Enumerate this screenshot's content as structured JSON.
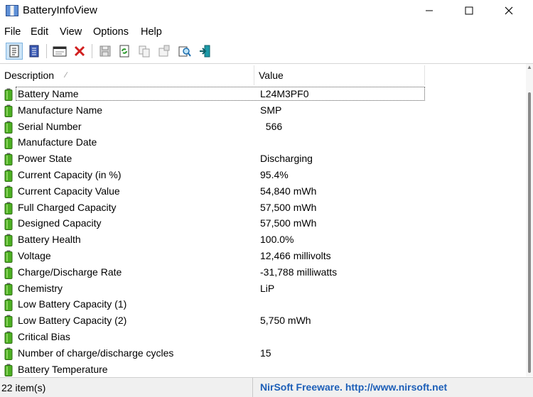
{
  "window": {
    "title": "BatteryInfoView"
  },
  "menu": [
    "File",
    "Edit",
    "View",
    "Options",
    "Help"
  ],
  "toolbar": {
    "buttons": [
      {
        "name": "html-report-icon",
        "active": true
      },
      {
        "name": "html-report-selected-icon",
        "active": false
      },
      {
        "name": "properties-icon",
        "active": false
      },
      {
        "name": "delete-icon",
        "active": false
      },
      {
        "name": "save-icon",
        "active": false
      },
      {
        "name": "refresh-icon",
        "active": false
      },
      {
        "name": "copy-icon",
        "active": false
      },
      {
        "name": "options-icon",
        "active": false
      },
      {
        "name": "find-icon",
        "active": false
      },
      {
        "name": "exit-icon",
        "active": false
      }
    ]
  },
  "list": {
    "columns": {
      "description": "Description",
      "value": "Value"
    },
    "rows": [
      {
        "description": "Battery Name",
        "value": "L24M3PF0"
      },
      {
        "description": "Manufacture Name",
        "value": "SMP"
      },
      {
        "description": "Serial Number",
        "value": "  566"
      },
      {
        "description": "Manufacture Date",
        "value": ""
      },
      {
        "description": "Power State",
        "value": "Discharging"
      },
      {
        "description": "Current Capacity (in %)",
        "value": "95.4%"
      },
      {
        "description": "Current Capacity Value",
        "value": "54,840 mWh"
      },
      {
        "description": "Full Charged Capacity",
        "value": "57,500 mWh"
      },
      {
        "description": "Designed Capacity",
        "value": "57,500 mWh"
      },
      {
        "description": "Battery Health",
        "value": "100.0%"
      },
      {
        "description": "Voltage",
        "value": "12,466 millivolts"
      },
      {
        "description": "Charge/Discharge Rate",
        "value": "-31,788 milliwatts"
      },
      {
        "description": "Chemistry",
        "value": "LiP"
      },
      {
        "description": "Low Battery Capacity (1)",
        "value": ""
      },
      {
        "description": "Low Battery Capacity (2)",
        "value": "5,750 mWh"
      },
      {
        "description": "Critical Bias",
        "value": ""
      },
      {
        "description": "Number of charge/discharge cycles",
        "value": "15"
      },
      {
        "description": "Battery Temperature",
        "value": ""
      }
    ]
  },
  "status": {
    "item_count": "22 item(s)",
    "link": "NirSoft Freeware.  http://www.nirsoft.net"
  },
  "colors": {
    "battery_green": "#4caf22",
    "link_blue": "#1d5fb8",
    "selection_blue": "#cce4f7"
  }
}
